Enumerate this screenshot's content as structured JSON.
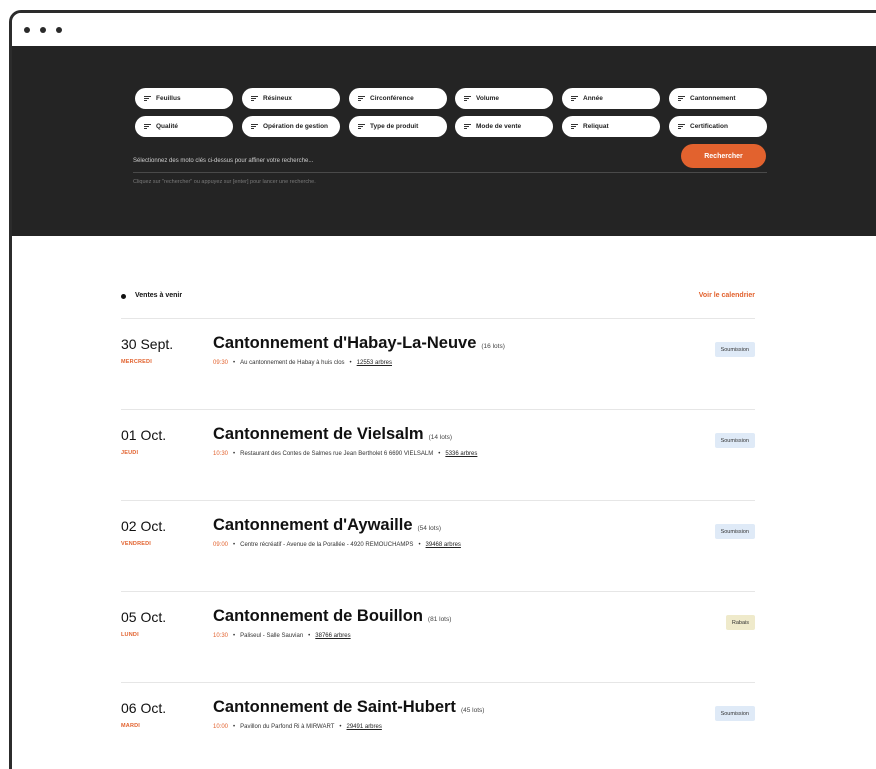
{
  "filters": [
    {
      "label": "Feuillus"
    },
    {
      "label": "Résineux"
    },
    {
      "label": "Circonférence"
    },
    {
      "label": "Volume"
    },
    {
      "label": "Année"
    },
    {
      "label": "Cantonnement"
    },
    {
      "label": "Qualité"
    },
    {
      "label": "Opération de gestion"
    },
    {
      "label": "Type de produit"
    },
    {
      "label": "Mode de vente"
    },
    {
      "label": "Reliquat"
    },
    {
      "label": "Certification"
    }
  ],
  "search": {
    "placeholder": "Sélectionnez des moto clés ci-dessus pour affiner votre recherche...",
    "hint": "Cliquez sur \"rechercher\" ou appuyez sur [enter] pour lancer une recherche.",
    "button_label": "Rechercher"
  },
  "section": {
    "title": "Ventes à venir",
    "calendar_link": "Voir le calendrier"
  },
  "sales": [
    {
      "date": "30 Sept.",
      "day": "MERCREDI",
      "title": "Cantonnement d'Habay-La-Neuve",
      "lots": "(16 lots)",
      "time": "09:30",
      "location": "Au cantonnement de Habay à huis clos",
      "trees": "12553 arbres",
      "badge": "Soumission",
      "badge_color": "#dfeaf7"
    },
    {
      "date": "01 Oct.",
      "day": "JEUDI",
      "title": "Cantonnement de Vielsalm",
      "lots": "(14 lots)",
      "time": "10:30",
      "location": "Restaurant des Contes de Salmes rue Jean Bertholet 6 6690 VIELSALM",
      "trees": "5336 arbres",
      "badge": "Soumission",
      "badge_color": "#dfeaf7"
    },
    {
      "date": "02 Oct.",
      "day": "VENDREDI",
      "title": "Cantonnement d'Aywaille",
      "lots": "(54 lots)",
      "time": "09:00",
      "location": "Centre récréatif - Avenue de la Porallée - 4920 REMOUCHAMPS",
      "trees": "39468 arbres",
      "badge": "Soumission",
      "badge_color": "#dfeaf7"
    },
    {
      "date": "05 Oct.",
      "day": "LUNDI",
      "title": "Cantonnement de Bouillon",
      "lots": "(81 lots)",
      "time": "10:30",
      "location": "Paliseul - Salle Sauvian",
      "trees": "38766 arbres",
      "badge": "Rabais",
      "badge_color": "#efeacb"
    },
    {
      "date": "06 Oct.",
      "day": "MARDI",
      "title": "Cantonnement de Saint-Hubert",
      "lots": "(45 lots)",
      "time": "10:00",
      "location": "Pavillon du Parfond Ri à MIRWART",
      "trees": "29491 arbres",
      "badge": "Soumission",
      "badge_color": "#dfeaf7"
    }
  ]
}
